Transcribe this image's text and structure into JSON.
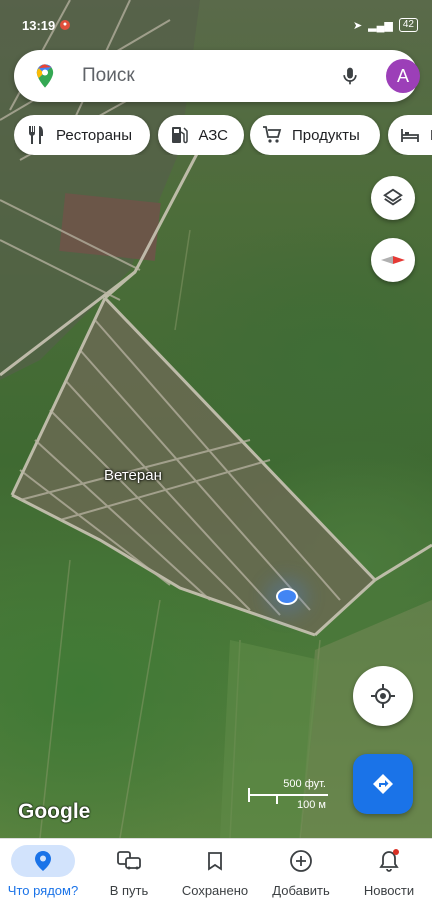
{
  "status_bar": {
    "time": "13:19",
    "battery": "42"
  },
  "search": {
    "placeholder": "Поиск",
    "avatar_letter": "A"
  },
  "chips": [
    {
      "label": "Рестораны",
      "icon": "fork-knife-icon"
    },
    {
      "label": "АЗС",
      "icon": "gas-station-icon"
    },
    {
      "label": "Продукты",
      "icon": "shopping-cart-icon"
    },
    {
      "label": "Го",
      "icon": "hotel-bed-icon"
    }
  ],
  "map": {
    "place_label": "Ветеран",
    "attribution": "Google",
    "scale_imperial": "500 фут.",
    "scale_metric": "100 м"
  },
  "bottom_nav": [
    {
      "label": "Что рядом?",
      "icon": "location-pin-icon",
      "active": true
    },
    {
      "label": "В путь",
      "icon": "commute-icon",
      "active": false
    },
    {
      "label": "Сохранено",
      "icon": "bookmark-icon",
      "active": false
    },
    {
      "label": "Добавить",
      "icon": "add-circle-icon",
      "active": false
    },
    {
      "label": "Новости",
      "icon": "bell-icon",
      "active": false
    }
  ],
  "colors": {
    "accent": "#1a73e8",
    "directions": "#1a73e8",
    "avatar": "#9c3fb8",
    "location": "#4285f4"
  }
}
